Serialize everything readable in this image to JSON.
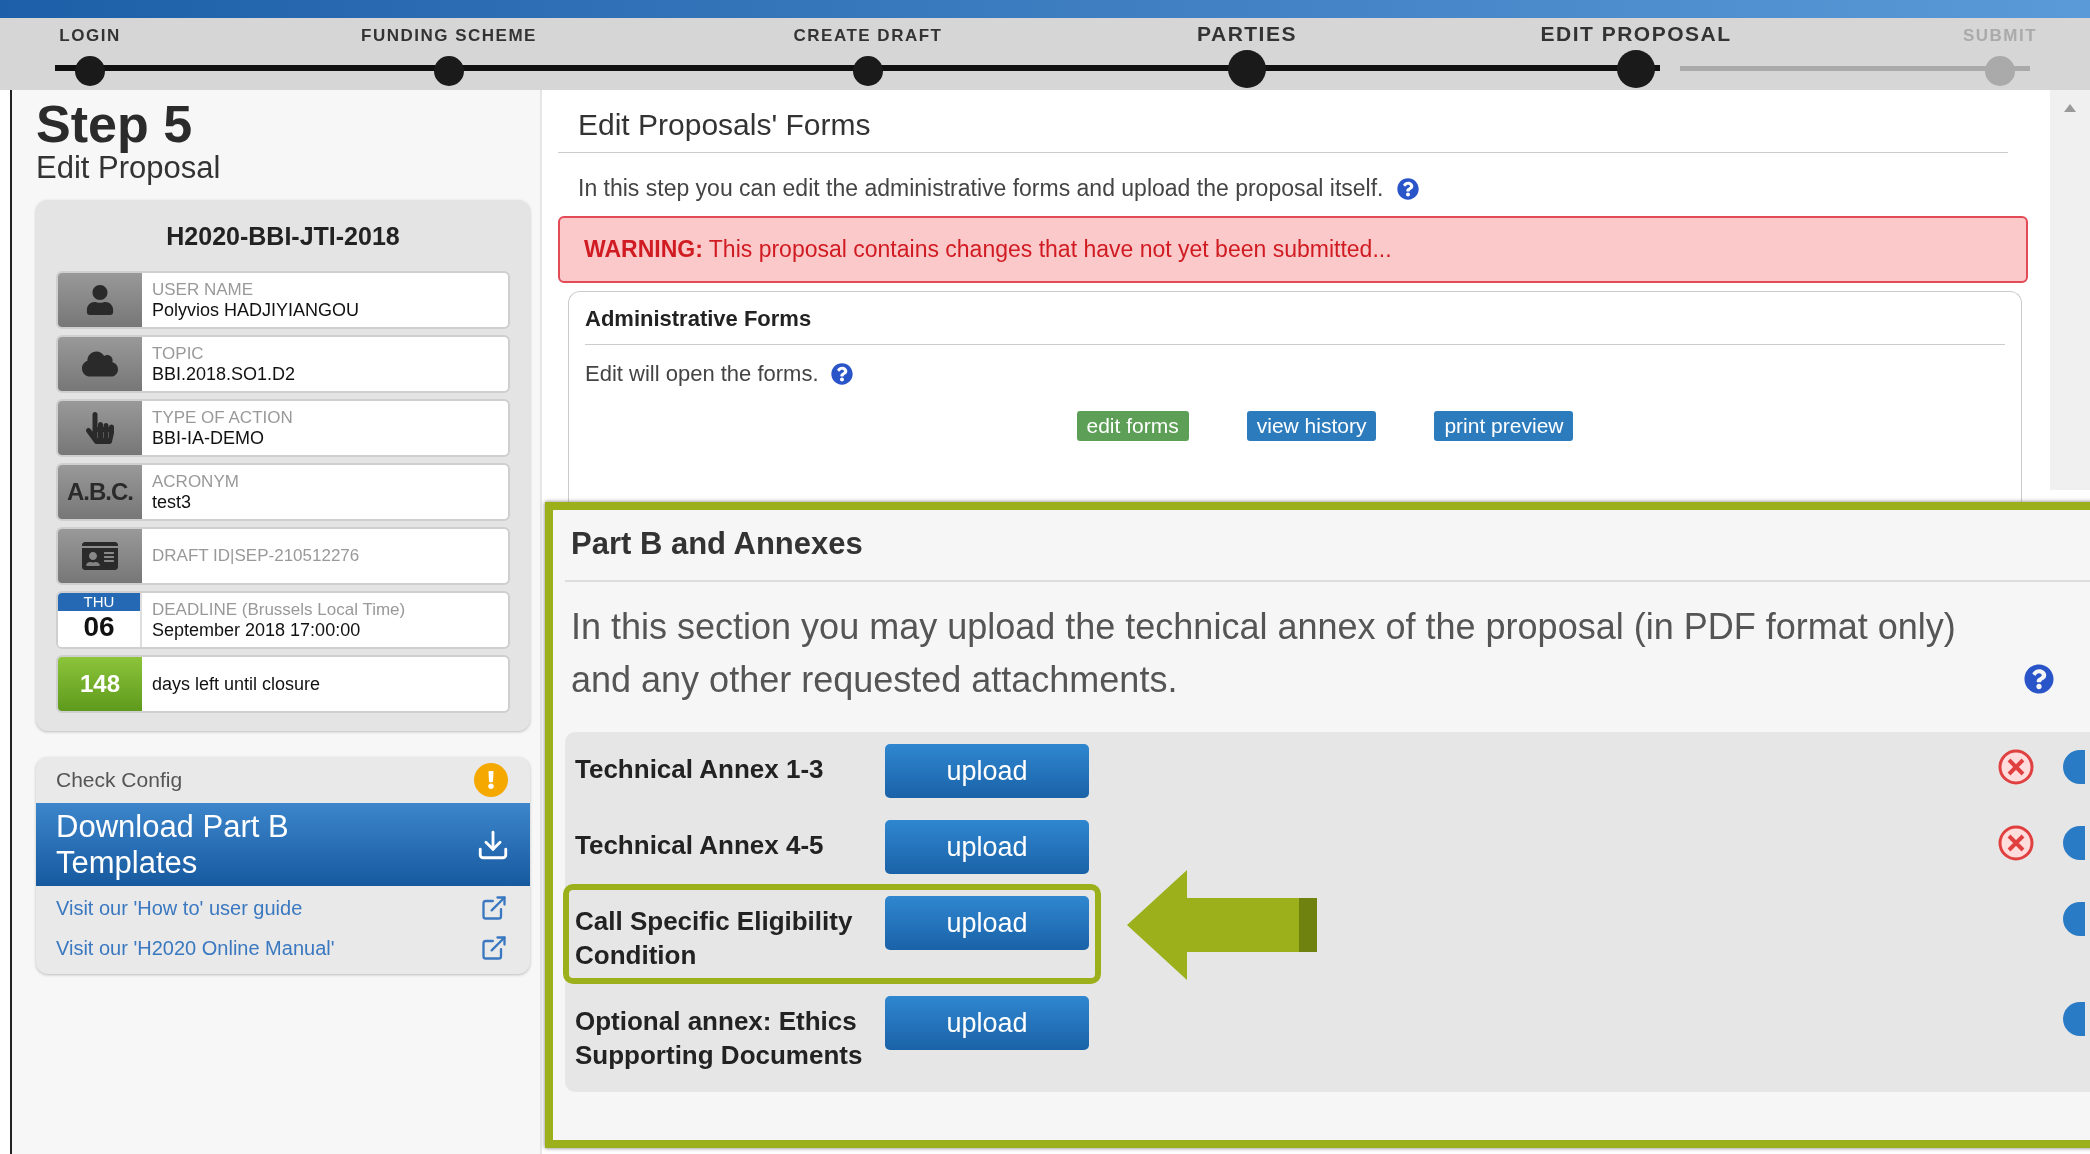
{
  "progress": {
    "steps": [
      {
        "label": "LOGIN",
        "large": false,
        "disabled": false
      },
      {
        "label": "FUNDING SCHEME",
        "large": false,
        "disabled": false
      },
      {
        "label": "CREATE DRAFT",
        "large": false,
        "disabled": false
      },
      {
        "label": "PARTIES",
        "large": true,
        "disabled": false
      },
      {
        "label": "EDIT PROPOSAL",
        "large": true,
        "disabled": false
      },
      {
        "label": "SUBMIT",
        "large": false,
        "disabled": true
      }
    ]
  },
  "sidebar": {
    "step": "Step 5",
    "step_title": "Edit Proposal",
    "call_id": "H2020-BBI-JTI-2018",
    "info_rows": [
      {
        "kind": "user",
        "label": "USER NAME",
        "value": "Polyvios HADJIYIANGOU"
      },
      {
        "kind": "cloud",
        "label": "TOPIC",
        "value": "BBI.2018.SO1.D2"
      },
      {
        "kind": "hand",
        "label": "TYPE OF ACTION",
        "value": "BBI-IA-DEMO"
      },
      {
        "kind": "abc",
        "icon_text": "A.B.C.",
        "label": "ACRONYM",
        "value": "test3"
      },
      {
        "kind": "idcard",
        "label": "DRAFT ID|SEP-210512276"
      },
      {
        "kind": "calendar",
        "day": "THU",
        "date": "06",
        "label": "DEADLINE (Brussels Local Time)",
        "value": "September 2018 17:00:00"
      },
      {
        "kind": "count",
        "count": "148",
        "value": "days left until closure"
      }
    ],
    "check_config": "Check Config",
    "download": "Download Part B Templates",
    "links": [
      "Visit our 'How to' user guide",
      "Visit our 'H2020 Online Manual'"
    ]
  },
  "main": {
    "title": "Edit Proposals' Forms",
    "description": "In this step you can edit the administrative forms and upload the proposal itself.",
    "warning": "**WARNING:** This proposal contains changes that have not yet been submitted...",
    "admin": {
      "title": "Administrative Forms",
      "text": "Edit will open the forms.",
      "buttons": [
        {
          "label": "edit forms",
          "kind": "green"
        },
        {
          "label": "view history",
          "kind": "blue"
        },
        {
          "label": "print preview",
          "kind": "blue"
        }
      ]
    }
  },
  "part_b": {
    "title": "Part B and Annexes",
    "text": "In this section you may upload the technical annex of the proposal (in PDF format only) and any other requested attachments.",
    "rows": [
      {
        "label": "Technical Annex 1-3",
        "button": "upload",
        "removable": true,
        "highlighted": false
      },
      {
        "label": "Technical Annex 4-5",
        "button": "upload",
        "removable": true,
        "highlighted": false
      },
      {
        "label": "Call Specific Eligibility Condition",
        "button": "upload",
        "removable": false,
        "highlighted": true
      },
      {
        "label": "Optional annex: Ethics Supporting Documents",
        "button": "upload",
        "removable": false,
        "highlighted": false
      }
    ]
  }
}
